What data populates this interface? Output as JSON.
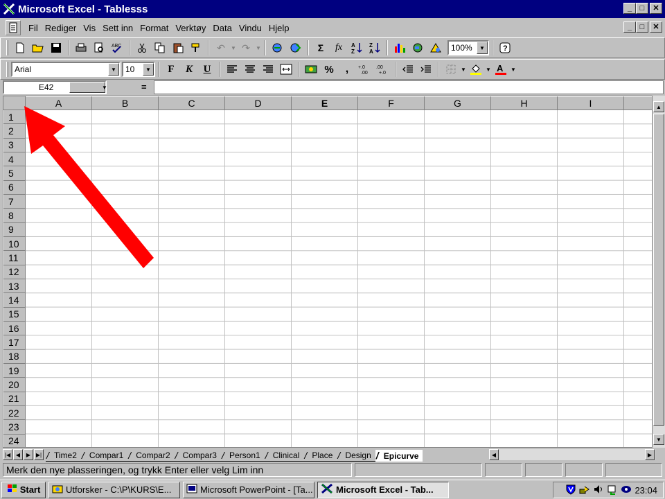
{
  "window": {
    "title": "Microsoft Excel - Tablesss",
    "minimize": "_",
    "maximize": "□",
    "close": "✕"
  },
  "menu": {
    "items": [
      "Fil",
      "Rediger",
      "Vis",
      "Sett inn",
      "Format",
      "Verktøy",
      "Data",
      "Vindu",
      "Hjelp"
    ]
  },
  "toolbar": {
    "zoom": "100%",
    "font_name": "Arial",
    "font_size": "10",
    "bold_label": "F",
    "italic_label": "K",
    "underline_label": "U",
    "percent_label": "%",
    "comma_label": ",",
    "sigma_label": "Σ",
    "fx_label": "fx"
  },
  "formula_bar": {
    "name_box": "E42",
    "equals": "=",
    "value": ""
  },
  "grid": {
    "columns": [
      "A",
      "B",
      "C",
      "D",
      "E",
      "F",
      "G",
      "H",
      "I"
    ],
    "active_column": "E",
    "rows": [
      "1",
      "2",
      "3",
      "4",
      "5",
      "6",
      "7",
      "8",
      "9",
      "10",
      "11",
      "12",
      "13",
      "14",
      "15",
      "16",
      "17",
      "18",
      "19",
      "20",
      "21",
      "22",
      "23",
      "24"
    ]
  },
  "sheets": {
    "tabs": [
      "Time2",
      "Compar1",
      "Compar2",
      "Compar3",
      "Person1",
      "Clinical",
      "Place",
      "Design",
      "Epicurve"
    ],
    "active": "Epicurve"
  },
  "status": {
    "message": "Merk den nye plasseringen, og trykk Enter eller velg Lim inn"
  },
  "taskbar": {
    "start_label": "Start",
    "tasks": [
      {
        "label": "Utforsker - C:\\P\\KURS\\E..."
      },
      {
        "label": "Microsoft PowerPoint - [Ta..."
      },
      {
        "label": "Microsoft Excel - Tab..."
      }
    ],
    "clock": "23:04"
  },
  "annotation": {
    "arrow_color": "#ff0000"
  }
}
